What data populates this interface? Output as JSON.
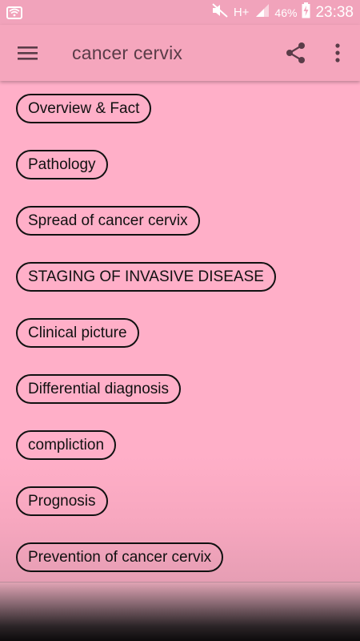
{
  "status_bar": {
    "battery_percent": "46%",
    "time": "23:38",
    "network": "H+",
    "icons": [
      "wifi-icon",
      "mute-icon",
      "network-arrows-icon",
      "signal-icon",
      "battery-charging-icon"
    ]
  },
  "app_bar": {
    "title": "cancer cervix",
    "icons": [
      "hamburger-menu-icon",
      "share-icon",
      "overflow-menu-icon"
    ]
  },
  "topics": [
    "Overview & Fact",
    "Pathology",
    "Spread of cancer cervix",
    "STAGING OF INVASIVE DISEASE",
    "Clinical picture",
    "Differential diagnosis",
    "compliction",
    "Prognosis",
    "Prevention of cancer cervix"
  ],
  "colors": {
    "background": "#ffafc8",
    "app_bar": "#f5a6bd",
    "title_text": "#5a3c48",
    "chip_border": "#111111"
  }
}
